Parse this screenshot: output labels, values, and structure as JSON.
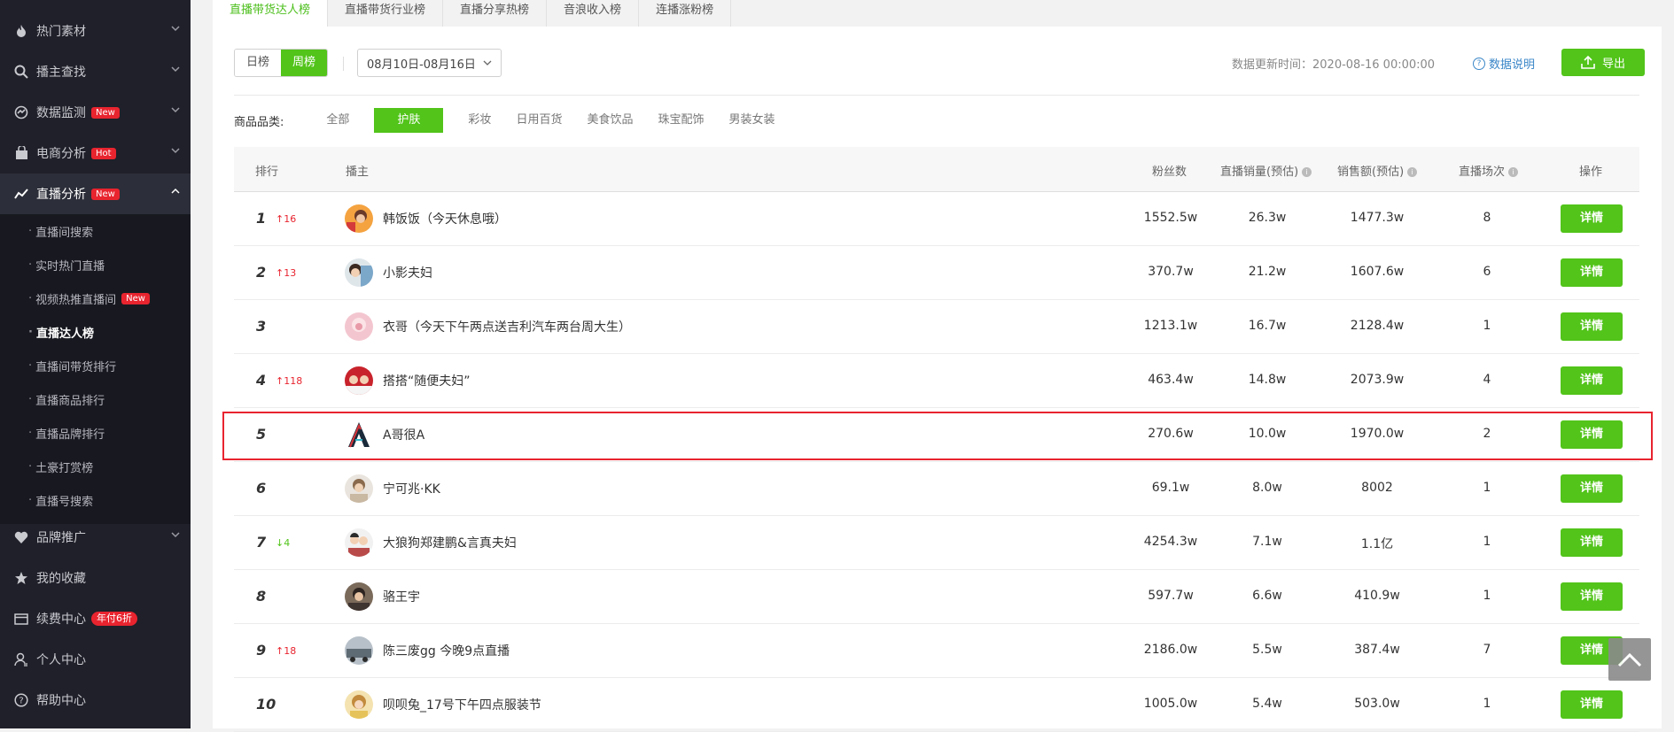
{
  "sidebar": {
    "items": [
      {
        "label": "热门素材",
        "icon": "fire-icon"
      },
      {
        "label": "播主查找",
        "icon": "search-icon"
      },
      {
        "label": "数据监测",
        "icon": "monitor-icon",
        "badge": "New"
      },
      {
        "label": "电商分析",
        "icon": "shopping-bag-icon",
        "badge": "Hot"
      },
      {
        "label": "直播分析",
        "icon": "trend-icon",
        "badge": "New"
      }
    ],
    "sub_items": [
      {
        "label": "直播间搜索"
      },
      {
        "label": "实时热门直播"
      },
      {
        "label": "视频热推直播间",
        "badge": "New"
      },
      {
        "label": "直播达人榜"
      },
      {
        "label": "直播间带货排行"
      },
      {
        "label": "直播商品排行"
      },
      {
        "label": "直播品牌排行"
      },
      {
        "label": "土豪打赏榜"
      },
      {
        "label": "直播号搜索"
      }
    ],
    "bottom_items": [
      {
        "label": "品牌推广",
        "icon": "heart-shield-icon"
      },
      {
        "label": "我的收藏",
        "icon": "star-icon"
      },
      {
        "label": "续费中心",
        "icon": "card-icon",
        "badge": "年付6折"
      },
      {
        "label": "个人中心",
        "icon": "user-icon"
      },
      {
        "label": "帮助中心",
        "icon": "help-icon"
      }
    ]
  },
  "tabs": [
    "直播带货达人榜",
    "直播带货行业榜",
    "直播分享热榜",
    "音浪收入榜",
    "连播涨粉榜"
  ],
  "toolbar": {
    "period_day": "日榜",
    "period_week": "周榜",
    "date_range": "08月10日-08月16日",
    "update_time": "数据更新时间：2020-08-16 00:00:00",
    "data_note": "数据说明",
    "export_label": "导出"
  },
  "categories": {
    "label": "商品品类:",
    "items": [
      "全部",
      "护肤",
      "彩妆",
      "日用百货",
      "美食饮品",
      "珠宝配饰",
      "男装女装"
    ],
    "selected": "护肤"
  },
  "table": {
    "headers": {
      "rank": "排行",
      "anchor": "播主",
      "fans": "粉丝数",
      "sales": "直播销量(预估)",
      "revenue": "销售额(预估)",
      "sessions": "直播场次",
      "action": "操作"
    },
    "action_label": "详情",
    "rows": [
      {
        "rank": "1",
        "delta": "↑16",
        "dir": "up",
        "name": "韩饭饭（今天休息哦）",
        "fans": "1552.5w",
        "sales": "26.3w",
        "revenue": "1477.3w",
        "sessions": "8"
      },
      {
        "rank": "2",
        "delta": "↑13",
        "dir": "up",
        "name": "小影夫妇",
        "fans": "370.7w",
        "sales": "21.2w",
        "revenue": "1607.6w",
        "sessions": "6"
      },
      {
        "rank": "3",
        "delta": "",
        "dir": "",
        "name": "衣哥（今天下午两点送吉利汽车两台周大生）",
        "fans": "1213.1w",
        "sales": "16.7w",
        "revenue": "2128.4w",
        "sessions": "1"
      },
      {
        "rank": "4",
        "delta": "↑118",
        "dir": "up",
        "name": "搭搭“随便夫妇”",
        "fans": "463.4w",
        "sales": "14.8w",
        "revenue": "2073.9w",
        "sessions": "4"
      },
      {
        "rank": "5",
        "delta": "",
        "dir": "",
        "name": "A哥很A",
        "fans": "270.6w",
        "sales": "10.0w",
        "revenue": "1970.0w",
        "sessions": "2"
      },
      {
        "rank": "6",
        "delta": "",
        "dir": "",
        "name": "宁可兆·KK",
        "fans": "69.1w",
        "sales": "8.0w",
        "revenue": "8002",
        "sessions": "1"
      },
      {
        "rank": "7",
        "delta": "↓4",
        "dir": "down",
        "name": "大狼狗郑建鹏&言真夫妇",
        "fans": "4254.3w",
        "sales": "7.1w",
        "revenue": "1.1亿",
        "sessions": "1"
      },
      {
        "rank": "8",
        "delta": "",
        "dir": "",
        "name": "骆王宇",
        "fans": "597.7w",
        "sales": "6.6w",
        "revenue": "410.9w",
        "sessions": "1"
      },
      {
        "rank": "9",
        "delta": "↑18",
        "dir": "up",
        "name": "陈三废gg 今晚9点直播",
        "fans": "2186.0w",
        "sales": "5.5w",
        "revenue": "387.4w",
        "sessions": "7"
      },
      {
        "rank": "10",
        "delta": "",
        "dir": "",
        "name": "呗呗兔_17号下午四点服装节",
        "fans": "1005.0w",
        "sales": "5.4w",
        "revenue": "503.0w",
        "sessions": "1"
      }
    ]
  },
  "colors": {
    "accent": "#52c41a",
    "sidebar_bg": "#1f2029",
    "badge_red": "#e8242f",
    "highlight": "#e8242f"
  }
}
